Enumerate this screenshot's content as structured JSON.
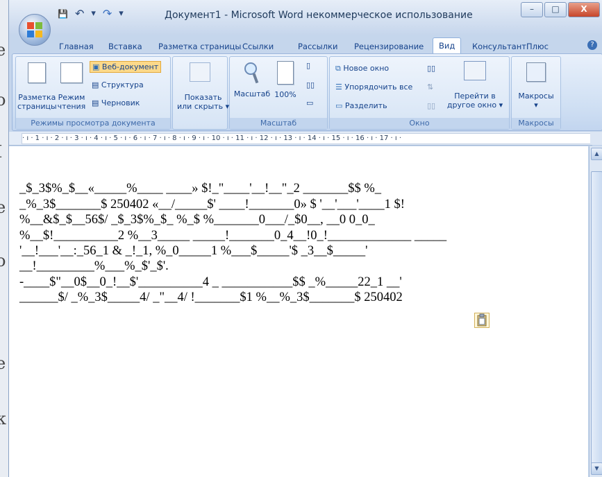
{
  "background_fragments": [
    "е",
    "о",
    "I",
    "е",
    "о",
    "е",
    "к"
  ],
  "title": "Документ1 - Microsoft Word некоммерческое использование",
  "window_controls": {
    "minimize": "–",
    "maximize": "□",
    "close": "X"
  },
  "quick_access": {
    "save": "💾",
    "undo": "↶",
    "undo_dropdown": "▾",
    "redo": "↷",
    "customize": "▾"
  },
  "tabs": [
    "Главная",
    "Вставка",
    "Разметка страницы",
    "Ссылки",
    "Рассылки",
    "Рецензирование",
    "Вид",
    "КонсультантПлюс"
  ],
  "active_tab": "Вид",
  "ribbon": {
    "view_modes": {
      "print_layout": "Разметка\nстраницы",
      "reading": "Режим\nчтения",
      "web": "Веб-документ",
      "outline": "Структура",
      "draft": "Черновик",
      "label": "Режимы просмотра документа"
    },
    "show": {
      "button": "Показать\nили скрыть ▾"
    },
    "zoom": {
      "zoom": "Масштаб",
      "percent": "100%",
      "label": "Масштаб"
    },
    "window": {
      "new_window": "Новое окно",
      "arrange_all": "Упорядочить все",
      "split": "Разделить",
      "switch": "Перейти в\nдругое окно ▾",
      "label": "Окно"
    },
    "macros": {
      "button": "Макросы\n▾",
      "label": "Макросы"
    }
  },
  "ruler_text": "· ı · 1 · ı · 2 · ı · 3 · ı · 4 · ı · 5 · ı · 6 · ı · 7 · ı · 8 · ı · 9 · ı · 10 · ı · 11 · ı · 12 · ı · 13 · ı · 14 · ı · 15 · ı · 16 · ı · 17 · ı ·",
  "document_lines": [
    "_$_3$%_$__«_____%____ ____» $!_\"____'__!__\"_2 _______$$ %_",
    "_%_3$_______$ 250402 «__/_____$' ____!_______0» $ '__'___'____1 $!",
    "%__&$_$__56$/ _$_3$%_$_ %_$ %_______0___/_$0__, __0 0_0_",
    "%__$!__________2 %__3_____ _____!_______0_4__!0_!_____________ _____",
    "'__!___'__:_56_1 & _!_1, %_0_____1 %___$_____'$ _3__$_____'",
    "__!_________%___%_$'_$'.",
    "-____$\"__0$__0_!__$'__________4 _ ___________$$ _%_____22_1 __'",
    "______$/ _%_3$_____4/ _\"__4/ !_______$1 %__%_3$_______$ 250402"
  ],
  "scrollbar": {
    "up": "▲",
    "down": "▼"
  }
}
